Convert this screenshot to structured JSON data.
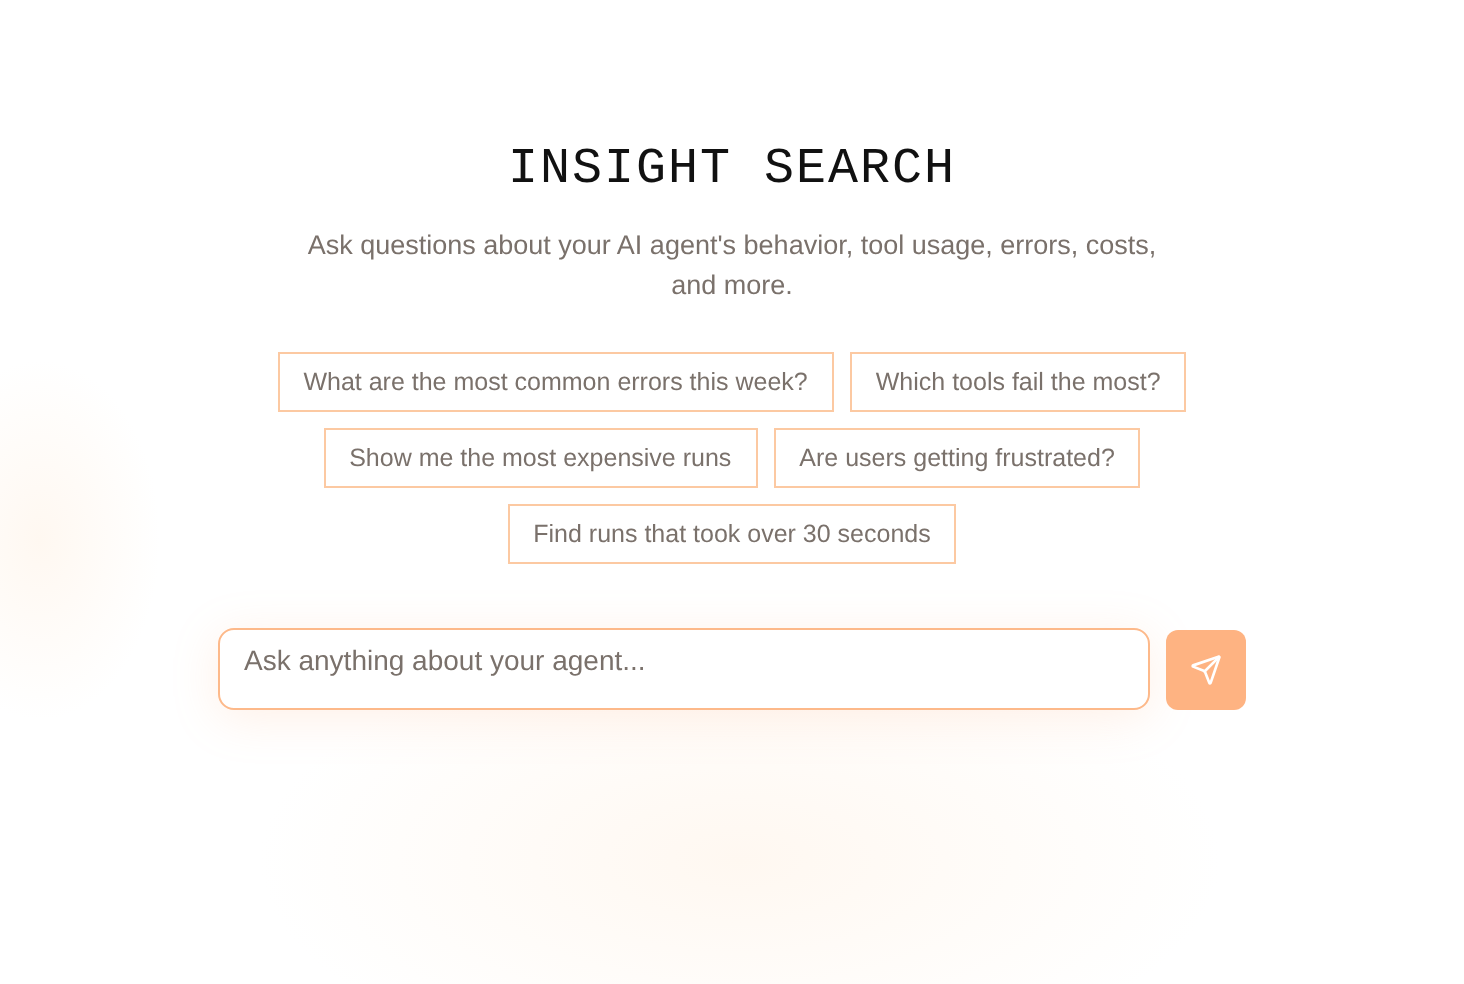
{
  "title": "INSIGHT SEARCH",
  "subtitle": "Ask questions about your AI agent's behavior, tool usage, errors, costs, and more.",
  "suggestions": [
    "What are the most common errors this week?",
    "Which tools fail the most?",
    "Show me the most expensive runs",
    "Are users getting frustrated?",
    "Find runs that took over 30 seconds"
  ],
  "search": {
    "placeholder": "Ask anything about your agent..."
  }
}
